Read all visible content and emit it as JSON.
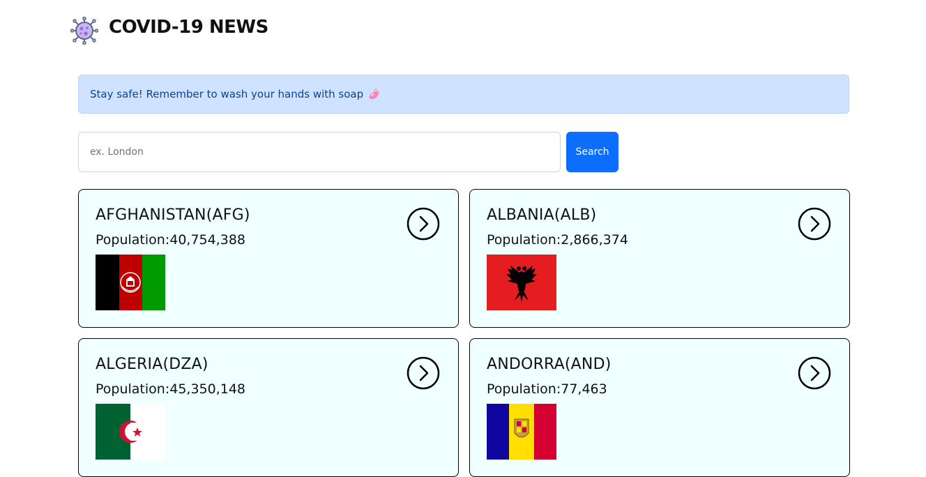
{
  "header": {
    "title": "COVID-19 NEWS",
    "logo_icon": "virus-icon"
  },
  "alert": {
    "text": "Stay safe! Remember to wash your hands with soap",
    "emoji_icon": "soap-icon",
    "bg_color": "#cfe2ff"
  },
  "search": {
    "placeholder": "ex. London",
    "value": "",
    "button_label": "Search",
    "button_color": "#0d6efd"
  },
  "countries": [
    {
      "name": "AFGHANISTAN(AFG)",
      "population": "Population:40,754,388",
      "flag": "afghanistan-flag"
    },
    {
      "name": "ALBANIA(ALB)",
      "population": "Population:2,866,374",
      "flag": "albania-flag"
    },
    {
      "name": "ALGERIA(DZA)",
      "population": "Population:45,350,148",
      "flag": "algeria-flag"
    },
    {
      "name": "ANDORRA(AND)",
      "population": "Population:77,463",
      "flag": "andorra-flag"
    }
  ],
  "card_bg_color": "#f0ffff"
}
